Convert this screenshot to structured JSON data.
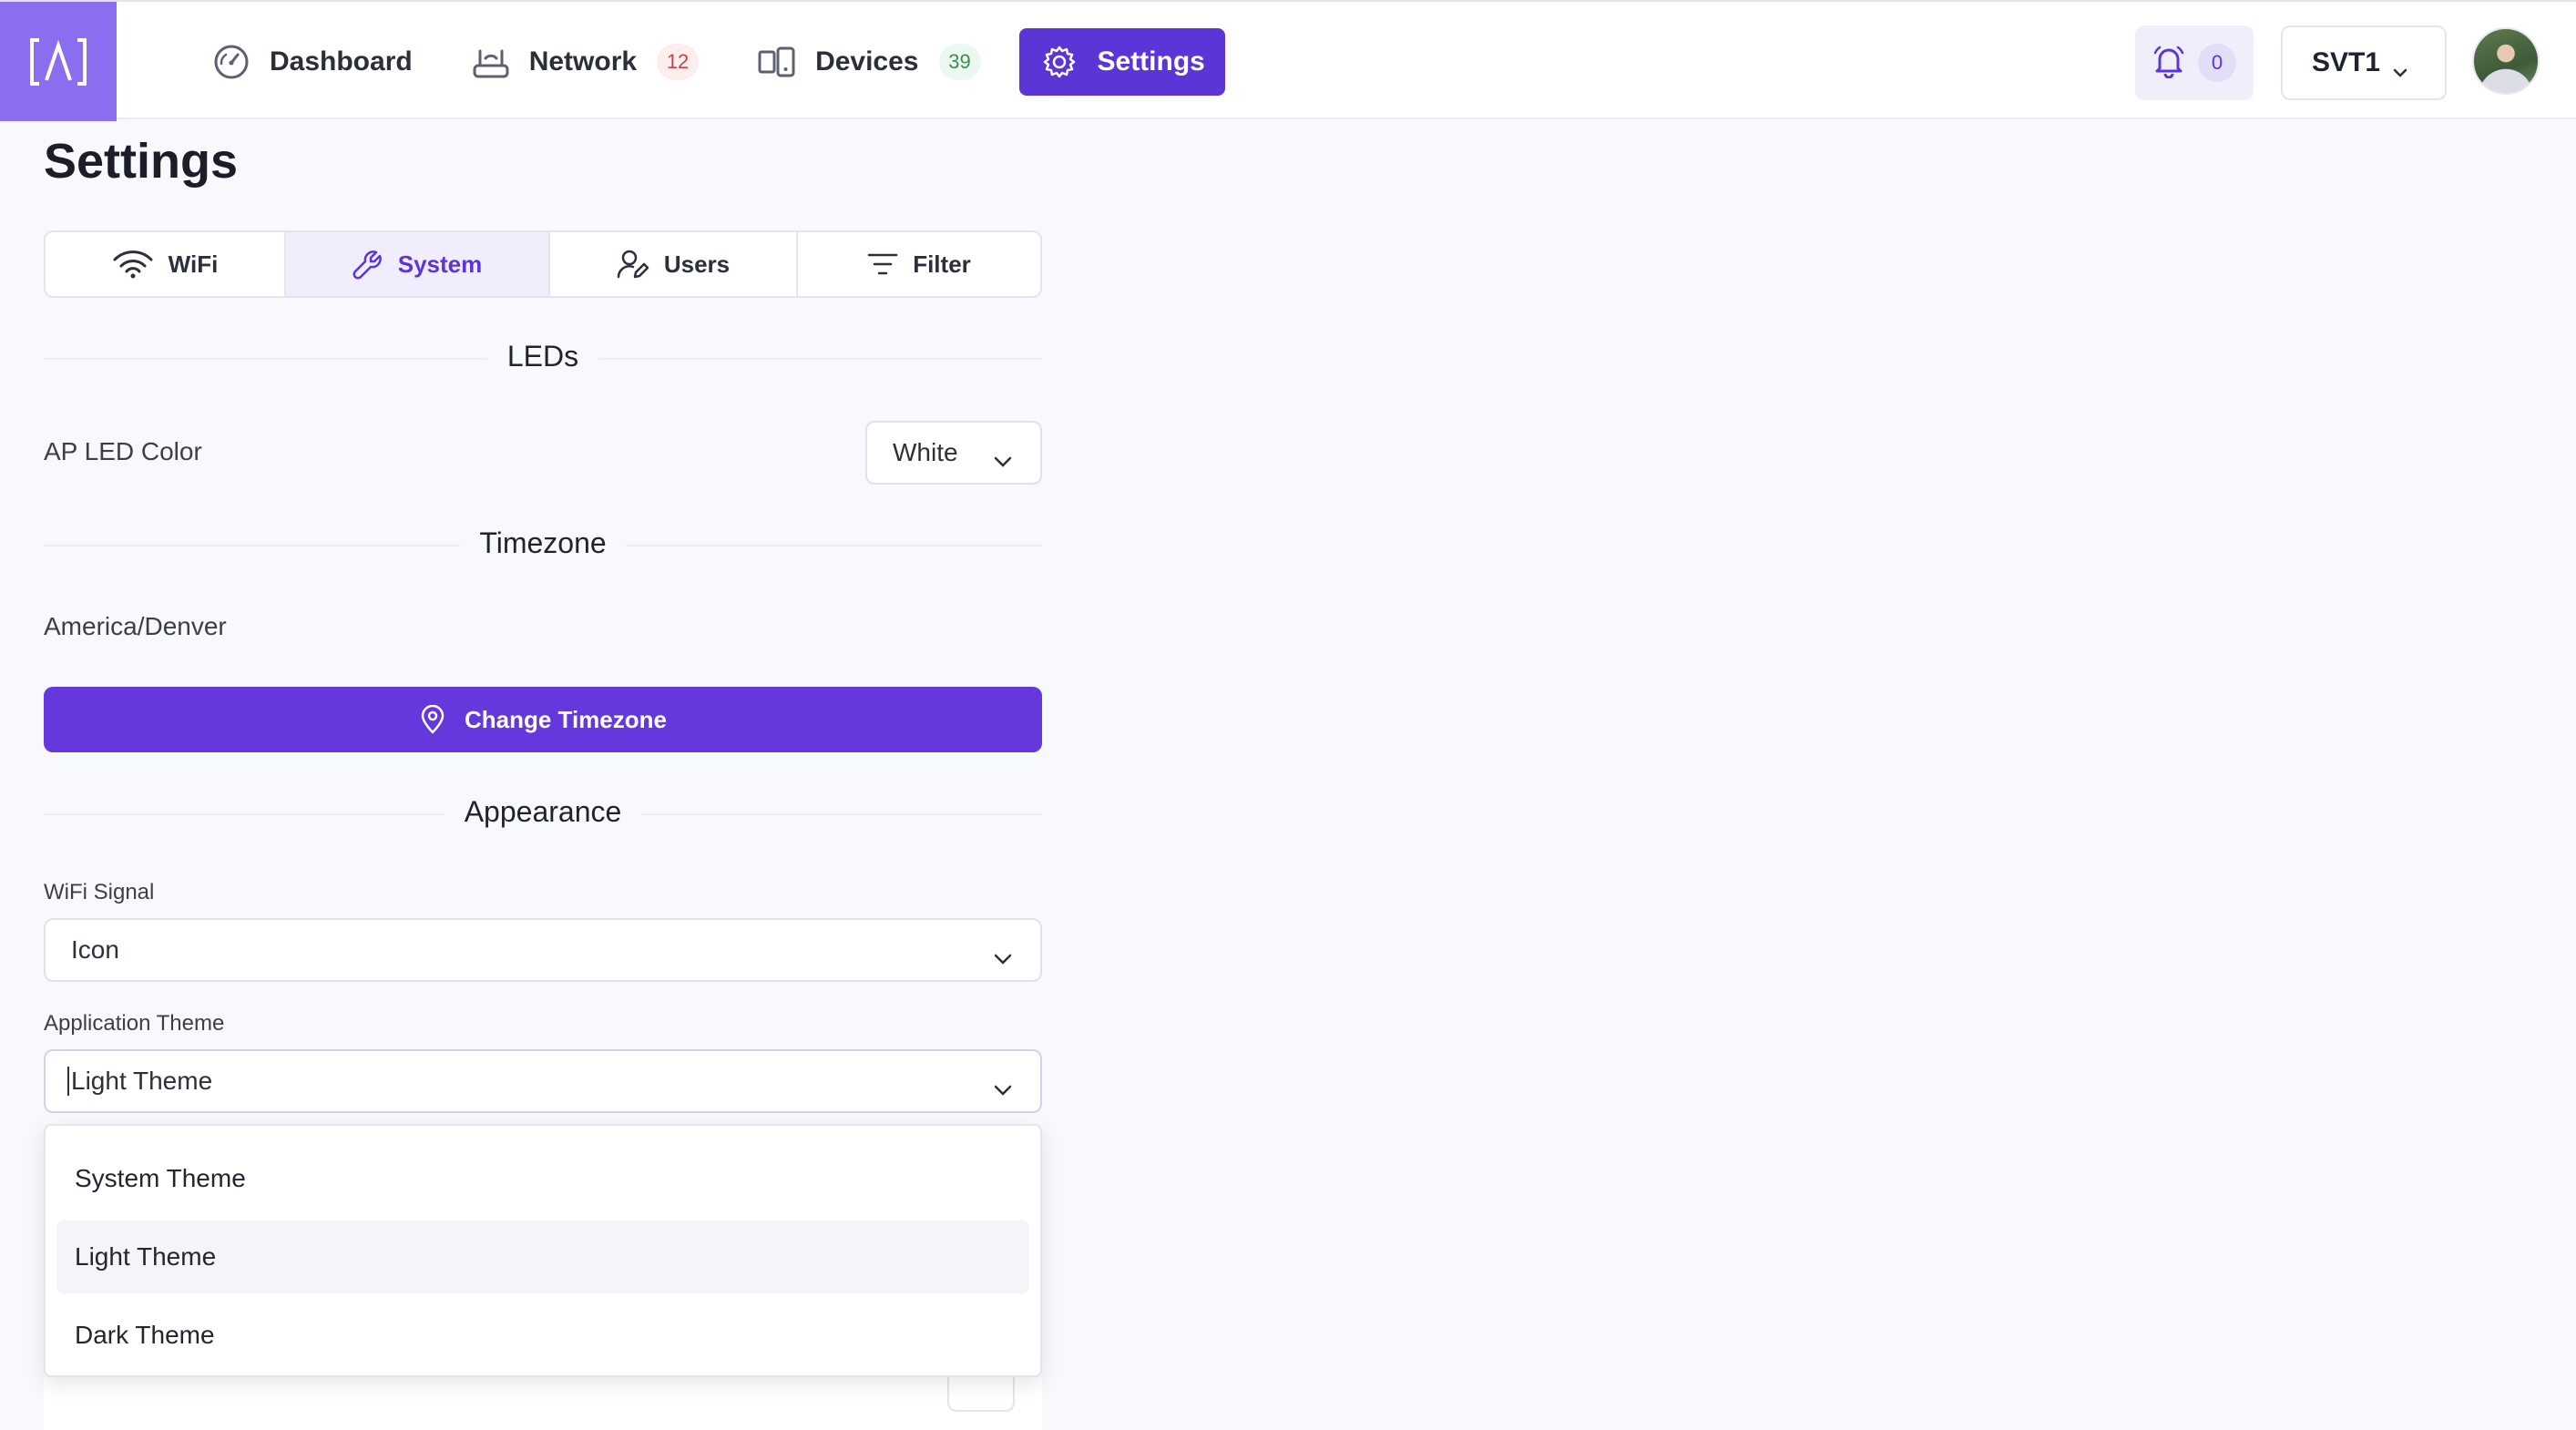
{
  "nav": {
    "items": [
      {
        "label": "Dashboard",
        "icon": "gauge-icon"
      },
      {
        "label": "Network",
        "icon": "router-icon",
        "badge": "12"
      },
      {
        "label": "Devices",
        "icon": "devices-icon",
        "badge": "39"
      },
      {
        "label": "Settings",
        "icon": "gear-icon",
        "active": true
      }
    ],
    "notifications": "0",
    "site": "SVT1"
  },
  "page": {
    "title": "Settings",
    "tabs": [
      {
        "label": "WiFi",
        "icon": "wifi-icon"
      },
      {
        "label": "System",
        "icon": "wrench-icon",
        "active": true
      },
      {
        "label": "Users",
        "icon": "user-edit-icon"
      },
      {
        "label": "Filter",
        "icon": "filter-icon"
      }
    ]
  },
  "leds": {
    "heading": "LEDs",
    "color_label": "AP LED Color",
    "color_value": "White"
  },
  "timezone": {
    "heading": "Timezone",
    "value": "America/Denver",
    "button": "Change Timezone"
  },
  "appearance": {
    "heading": "Appearance",
    "wifi_signal_label": "WiFi Signal",
    "wifi_signal_value": "Icon",
    "theme_label": "Application Theme",
    "theme_value": "Light Theme",
    "theme_options": [
      "System Theme",
      "Light Theme",
      "Dark Theme"
    ]
  },
  "colors": {
    "accent": "#5b35d5",
    "logo_bg": "#8b6ef0"
  }
}
